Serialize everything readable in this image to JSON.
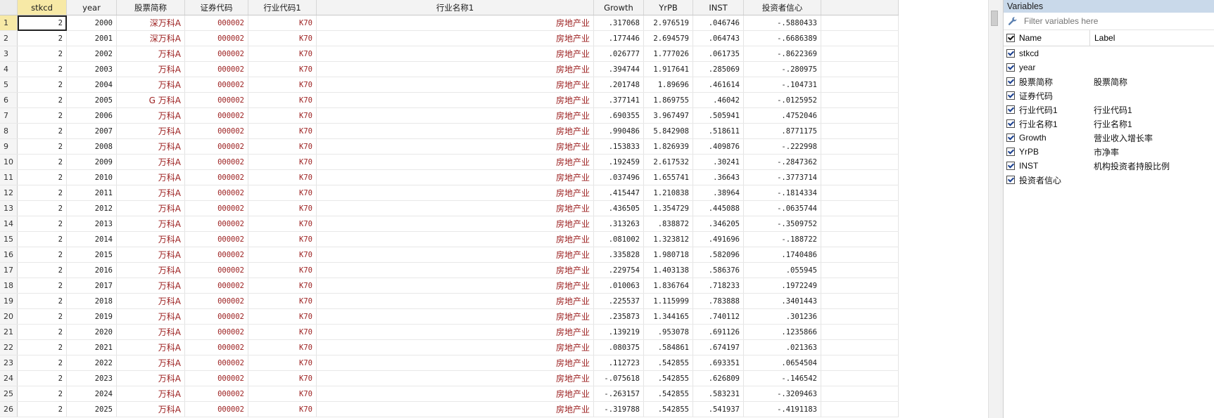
{
  "grid": {
    "columns": [
      "",
      "stkcd",
      "year",
      "股票简称",
      "证券代码",
      "行业代码1",
      "行业名称1",
      "Growth",
      "YrPB",
      "INST",
      "投资者信心"
    ],
    "rows": [
      [
        "1",
        "2",
        "2000",
        "深万科A",
        "000002",
        "K70",
        "房地产业",
        ".317068",
        "2.976519",
        ".046746",
        "-.5880433"
      ],
      [
        "2",
        "2",
        "2001",
        "深万科A",
        "000002",
        "K70",
        "房地产业",
        ".177446",
        "2.694579",
        ".064743",
        "-.6686389"
      ],
      [
        "3",
        "2",
        "2002",
        "万科A",
        "000002",
        "K70",
        "房地产业",
        ".026777",
        "1.777026",
        ".061735",
        "-.8622369"
      ],
      [
        "4",
        "2",
        "2003",
        "万科A",
        "000002",
        "K70",
        "房地产业",
        ".394744",
        "1.917641",
        ".285069",
        "-.280975"
      ],
      [
        "5",
        "2",
        "2004",
        "万科A",
        "000002",
        "K70",
        "房地产业",
        ".201748",
        "1.89696",
        ".461614",
        "-.104731"
      ],
      [
        "6",
        "2",
        "2005",
        "G 万科A",
        "000002",
        "K70",
        "房地产业",
        ".377141",
        "1.869755",
        ".46042",
        "-.0125952"
      ],
      [
        "7",
        "2",
        "2006",
        "万科A",
        "000002",
        "K70",
        "房地产业",
        ".690355",
        "3.967497",
        ".505941",
        ".4752046"
      ],
      [
        "8",
        "2",
        "2007",
        "万科A",
        "000002",
        "K70",
        "房地产业",
        ".990486",
        "5.842908",
        ".518611",
        ".8771175"
      ],
      [
        "9",
        "2",
        "2008",
        "万科A",
        "000002",
        "K70",
        "房地产业",
        ".153833",
        "1.826939",
        ".409876",
        "-.222998"
      ],
      [
        "10",
        "2",
        "2009",
        "万科A",
        "000002",
        "K70",
        "房地产业",
        ".192459",
        "2.617532",
        ".30241",
        "-.2847362"
      ],
      [
        "11",
        "2",
        "2010",
        "万科A",
        "000002",
        "K70",
        "房地产业",
        ".037496",
        "1.655741",
        ".36643",
        "-.3773714"
      ],
      [
        "12",
        "2",
        "2011",
        "万科A",
        "000002",
        "K70",
        "房地产业",
        ".415447",
        "1.210838",
        ".38964",
        "-.1814334"
      ],
      [
        "13",
        "2",
        "2012",
        "万科A",
        "000002",
        "K70",
        "房地产业",
        ".436505",
        "1.354729",
        ".445088",
        "-.0635744"
      ],
      [
        "14",
        "2",
        "2013",
        "万科A",
        "000002",
        "K70",
        "房地产业",
        ".313263",
        ".838872",
        ".346205",
        "-.3509752"
      ],
      [
        "15",
        "2",
        "2014",
        "万科A",
        "000002",
        "K70",
        "房地产业",
        ".081002",
        "1.323812",
        ".491696",
        "-.188722"
      ],
      [
        "16",
        "2",
        "2015",
        "万科A",
        "000002",
        "K70",
        "房地产业",
        ".335828",
        "1.980718",
        ".582096",
        ".1740486"
      ],
      [
        "17",
        "2",
        "2016",
        "万科A",
        "000002",
        "K70",
        "房地产业",
        ".229754",
        "1.403138",
        ".586376",
        ".055945"
      ],
      [
        "18",
        "2",
        "2017",
        "万科A",
        "000002",
        "K70",
        "房地产业",
        ".010063",
        "1.836764",
        ".718233",
        ".1972249"
      ],
      [
        "19",
        "2",
        "2018",
        "万科A",
        "000002",
        "K70",
        "房地产业",
        ".225537",
        "1.115999",
        ".783888",
        ".3401443"
      ],
      [
        "20",
        "2",
        "2019",
        "万科A",
        "000002",
        "K70",
        "房地产业",
        ".235873",
        "1.344165",
        ".740112",
        ".301236"
      ],
      [
        "21",
        "2",
        "2020",
        "万科A",
        "000002",
        "K70",
        "房地产业",
        ".139219",
        ".953078",
        ".691126",
        ".1235866"
      ],
      [
        "22",
        "2",
        "2021",
        "万科A",
        "000002",
        "K70",
        "房地产业",
        ".080375",
        ".584861",
        ".674197",
        ".021363"
      ],
      [
        "23",
        "2",
        "2022",
        "万科A",
        "000002",
        "K70",
        "房地产业",
        ".112723",
        ".542855",
        ".693351",
        ".0654504"
      ],
      [
        "24",
        "2",
        "2023",
        "万科A",
        "000002",
        "K70",
        "房地产业",
        "-.075618",
        ".542855",
        ".626809",
        "-.146542"
      ],
      [
        "25",
        "2",
        "2024",
        "万科A",
        "000002",
        "K70",
        "房地产业",
        "-.263157",
        ".542855",
        ".583231",
        "-.3209463"
      ],
      [
        "26",
        "2",
        "2025",
        "万科A",
        "000002",
        "K70",
        "房地产业",
        "-.319788",
        ".542855",
        ".541937",
        "-.4191183"
      ]
    ]
  },
  "variables_panel": {
    "title": "Variables",
    "filter_placeholder": "Filter variables here",
    "name_header": "Name",
    "label_header": "Label",
    "items": [
      {
        "name": "stkcd",
        "label": ""
      },
      {
        "name": "year",
        "label": ""
      },
      {
        "name": "股票简称",
        "label": "股票简称"
      },
      {
        "name": "证券代码",
        "label": ""
      },
      {
        "name": "行业代码1",
        "label": "行业代码1"
      },
      {
        "name": "行业名称1",
        "label": "行业名称1"
      },
      {
        "name": "Growth",
        "label": "营业收入增长率"
      },
      {
        "name": "YrPB",
        "label": "市净率"
      },
      {
        "name": "INST",
        "label": "机构投资者持股比例"
      },
      {
        "name": "投资者信心",
        "label": ""
      }
    ]
  },
  "colors": {
    "string_text": "#9b1d1d",
    "selected_header": "#f7e9a6",
    "panel_title": "#c9d9ea"
  },
  "icons": {
    "filter": "wrench-icon"
  }
}
